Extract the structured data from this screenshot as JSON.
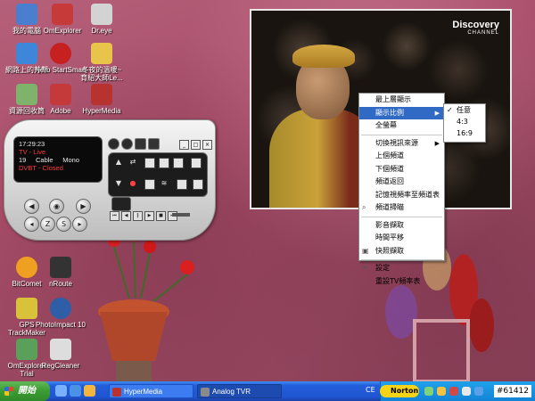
{
  "desktop_icons": [
    {
      "label": "我的電腦",
      "icon": "computer-icon",
      "color": "#4a7fd0"
    },
    {
      "label": "OmExplorer",
      "icon": "omexplorer-icon",
      "color": "#c63a3a"
    },
    {
      "label": "Dr.eye",
      "icon": "dreye-icon",
      "color": "#d3d3d3"
    },
    {
      "label": "網路上的芳鄰",
      "icon": "network-icon",
      "color": "#3e86d9"
    },
    {
      "label": "Nero StartSmart",
      "icon": "nero-icon",
      "color": "#c62020"
    },
    {
      "label": "冬夜的溫暖~",
      "label2": "育紹大師Le...",
      "icon": "folder-icon",
      "color": "#e8c44b"
    },
    {
      "label": "資源回收筒",
      "icon": "recycle-bin-icon",
      "color": "#7fb26a"
    },
    {
      "label": "Adobe",
      "icon": "adobe-icon",
      "color": "#c43a3a"
    },
    {
      "label": "HyperMedia",
      "icon": "hypermedia-icon",
      "color": "#b6332f"
    },
    {
      "label": "BitComet",
      "icon": "bitcomet-icon",
      "color": "#f0a020"
    },
    {
      "label": "nRoute",
      "icon": "nroute-icon",
      "color": "#333333"
    },
    {
      "label": "GPS",
      "label2": "TrackMaker",
      "icon": "gps-icon",
      "color": "#d8c23a"
    },
    {
      "label": "PhotoImpact 10",
      "icon": "photoimpact-icon",
      "color": "#2e5ea8"
    },
    {
      "label": "OmExplorer",
      "label2": "Trial",
      "icon": "omexplorer-trial-icon",
      "color": "#5aa05a"
    },
    {
      "label": "RegCleaner",
      "icon": "regcleaner-icon",
      "color": "#dddddd"
    }
  ],
  "video": {
    "logo": "Discovery",
    "logo_sub": "CHANNEL"
  },
  "context_menu": {
    "items": [
      {
        "label": "最上層顯示",
        "type": "item"
      },
      {
        "label": "顯示比例",
        "type": "submenu",
        "highlighted": true
      },
      {
        "label": "全螢幕",
        "type": "item"
      },
      {
        "type": "separator"
      },
      {
        "label": "切換視訊來源",
        "type": "submenu"
      },
      {
        "label": "上個頻道",
        "type": "item"
      },
      {
        "label": "下個頻道",
        "type": "item"
      },
      {
        "label": "頻道返回",
        "type": "item"
      },
      {
        "label": "記憶視頻率至頻道表",
        "type": "item"
      },
      {
        "label": "頻道掃瞄",
        "type": "item",
        "icon": "magnifier-icon"
      },
      {
        "type": "separator"
      },
      {
        "label": "影音擷取",
        "type": "item"
      },
      {
        "label": "時間平移",
        "type": "item"
      },
      {
        "label": "快照擷取",
        "type": "item",
        "icon": "camera-icon"
      },
      {
        "type": "separator"
      },
      {
        "label": "設定",
        "type": "item",
        "icon": "tools-icon"
      },
      {
        "label": "重設TV頻率表",
        "type": "item"
      }
    ],
    "submenu": [
      {
        "label": "任意",
        "checked": true
      },
      {
        "label": "4:3",
        "checked": false
      },
      {
        "label": "16:9",
        "checked": false
      }
    ]
  },
  "player": {
    "time": "17:29:23",
    "mode": "TV - Live",
    "channel": "19",
    "source": "Cable",
    "audio": "Mono",
    "dvbt": "DVBT - Closed",
    "joystick_labels": [
      "Z",
      "S"
    ]
  },
  "taskbar": {
    "start_label": "開始",
    "tasks": [
      {
        "label": "HyperMedia",
        "color": "#b6332f",
        "active": false
      },
      {
        "label": "Analog TVR",
        "color": "#8a8a8a",
        "active": true
      }
    ],
    "lang": "CE",
    "norton": "Norton",
    "clock": "#61412"
  }
}
